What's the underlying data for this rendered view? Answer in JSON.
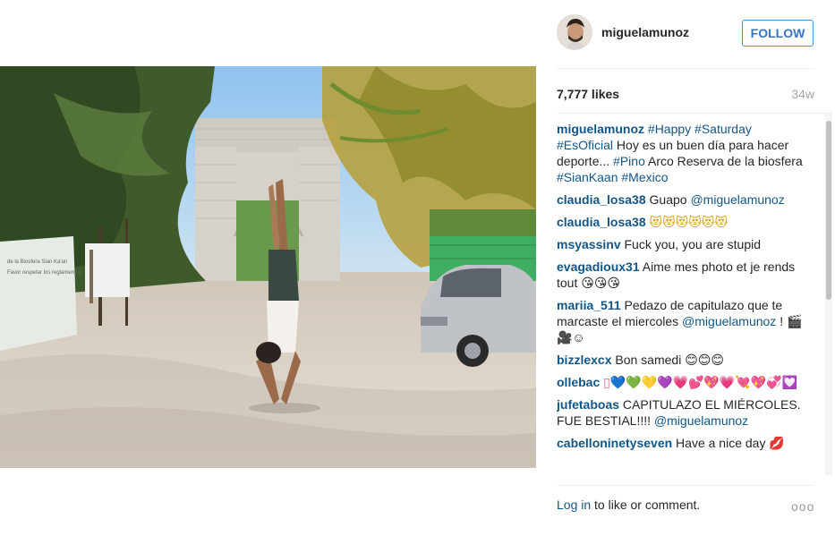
{
  "header": {
    "username": "miguelamunoz",
    "follow_label": "FOLLOW"
  },
  "stats": {
    "likes": "7,777 likes",
    "age": "34w"
  },
  "caption": {
    "user": "miguelamunoz",
    "tags1": "#Happy #Saturday",
    "tags2": "#EsOficial",
    "text1": " Hoy es un buen día para hacer deporte... ",
    "tags3": "#Pino",
    "text2": " Arco Reserva de la biosfera ",
    "tags4": "#SianKaan #Mexico"
  },
  "comments": [
    {
      "user": "claudia_losa38",
      "text": " Guapo ",
      "mention": "@miguelamunoz"
    },
    {
      "user": "claudia_losa38",
      "text": " 😻😻😻😻😻😻"
    },
    {
      "user": "msyassinv",
      "text": " Fuck you, you are stupid"
    },
    {
      "user": "evagadioux31",
      "text": " Aime mes photo et je rends tout 😘😘😘"
    },
    {
      "user": "mariia_511",
      "text": " Pedazo de capitulazo que te marcaste el miercoles ",
      "mention": "@miguelamunoz",
      "tail": " ! 🎬🎥☺"
    },
    {
      "user": "bizzlexcx",
      "text": " Bon samedi 😊😊😊"
    },
    {
      "user": "ollebac",
      "text": " ▯💙💚💛💜💗💕💖💗💘💖💞💟"
    },
    {
      "user": "jufetaboas",
      "text": " CAPITULAZO EL MIÉRCOLES. FUE BESTIAL!!!! ",
      "mention": "@miguelamunoz"
    },
    {
      "user": "cabelloninetyseven",
      "text": " Have a nice day 💋"
    }
  ],
  "footer": {
    "login": "Log in",
    "rest": " to like or comment.",
    "more": "ooo"
  },
  "photo": {
    "sign_text_1": "de la Biosfera Sian Ka'an",
    "sign_text_2": "Favor respetar los reglamentos"
  }
}
